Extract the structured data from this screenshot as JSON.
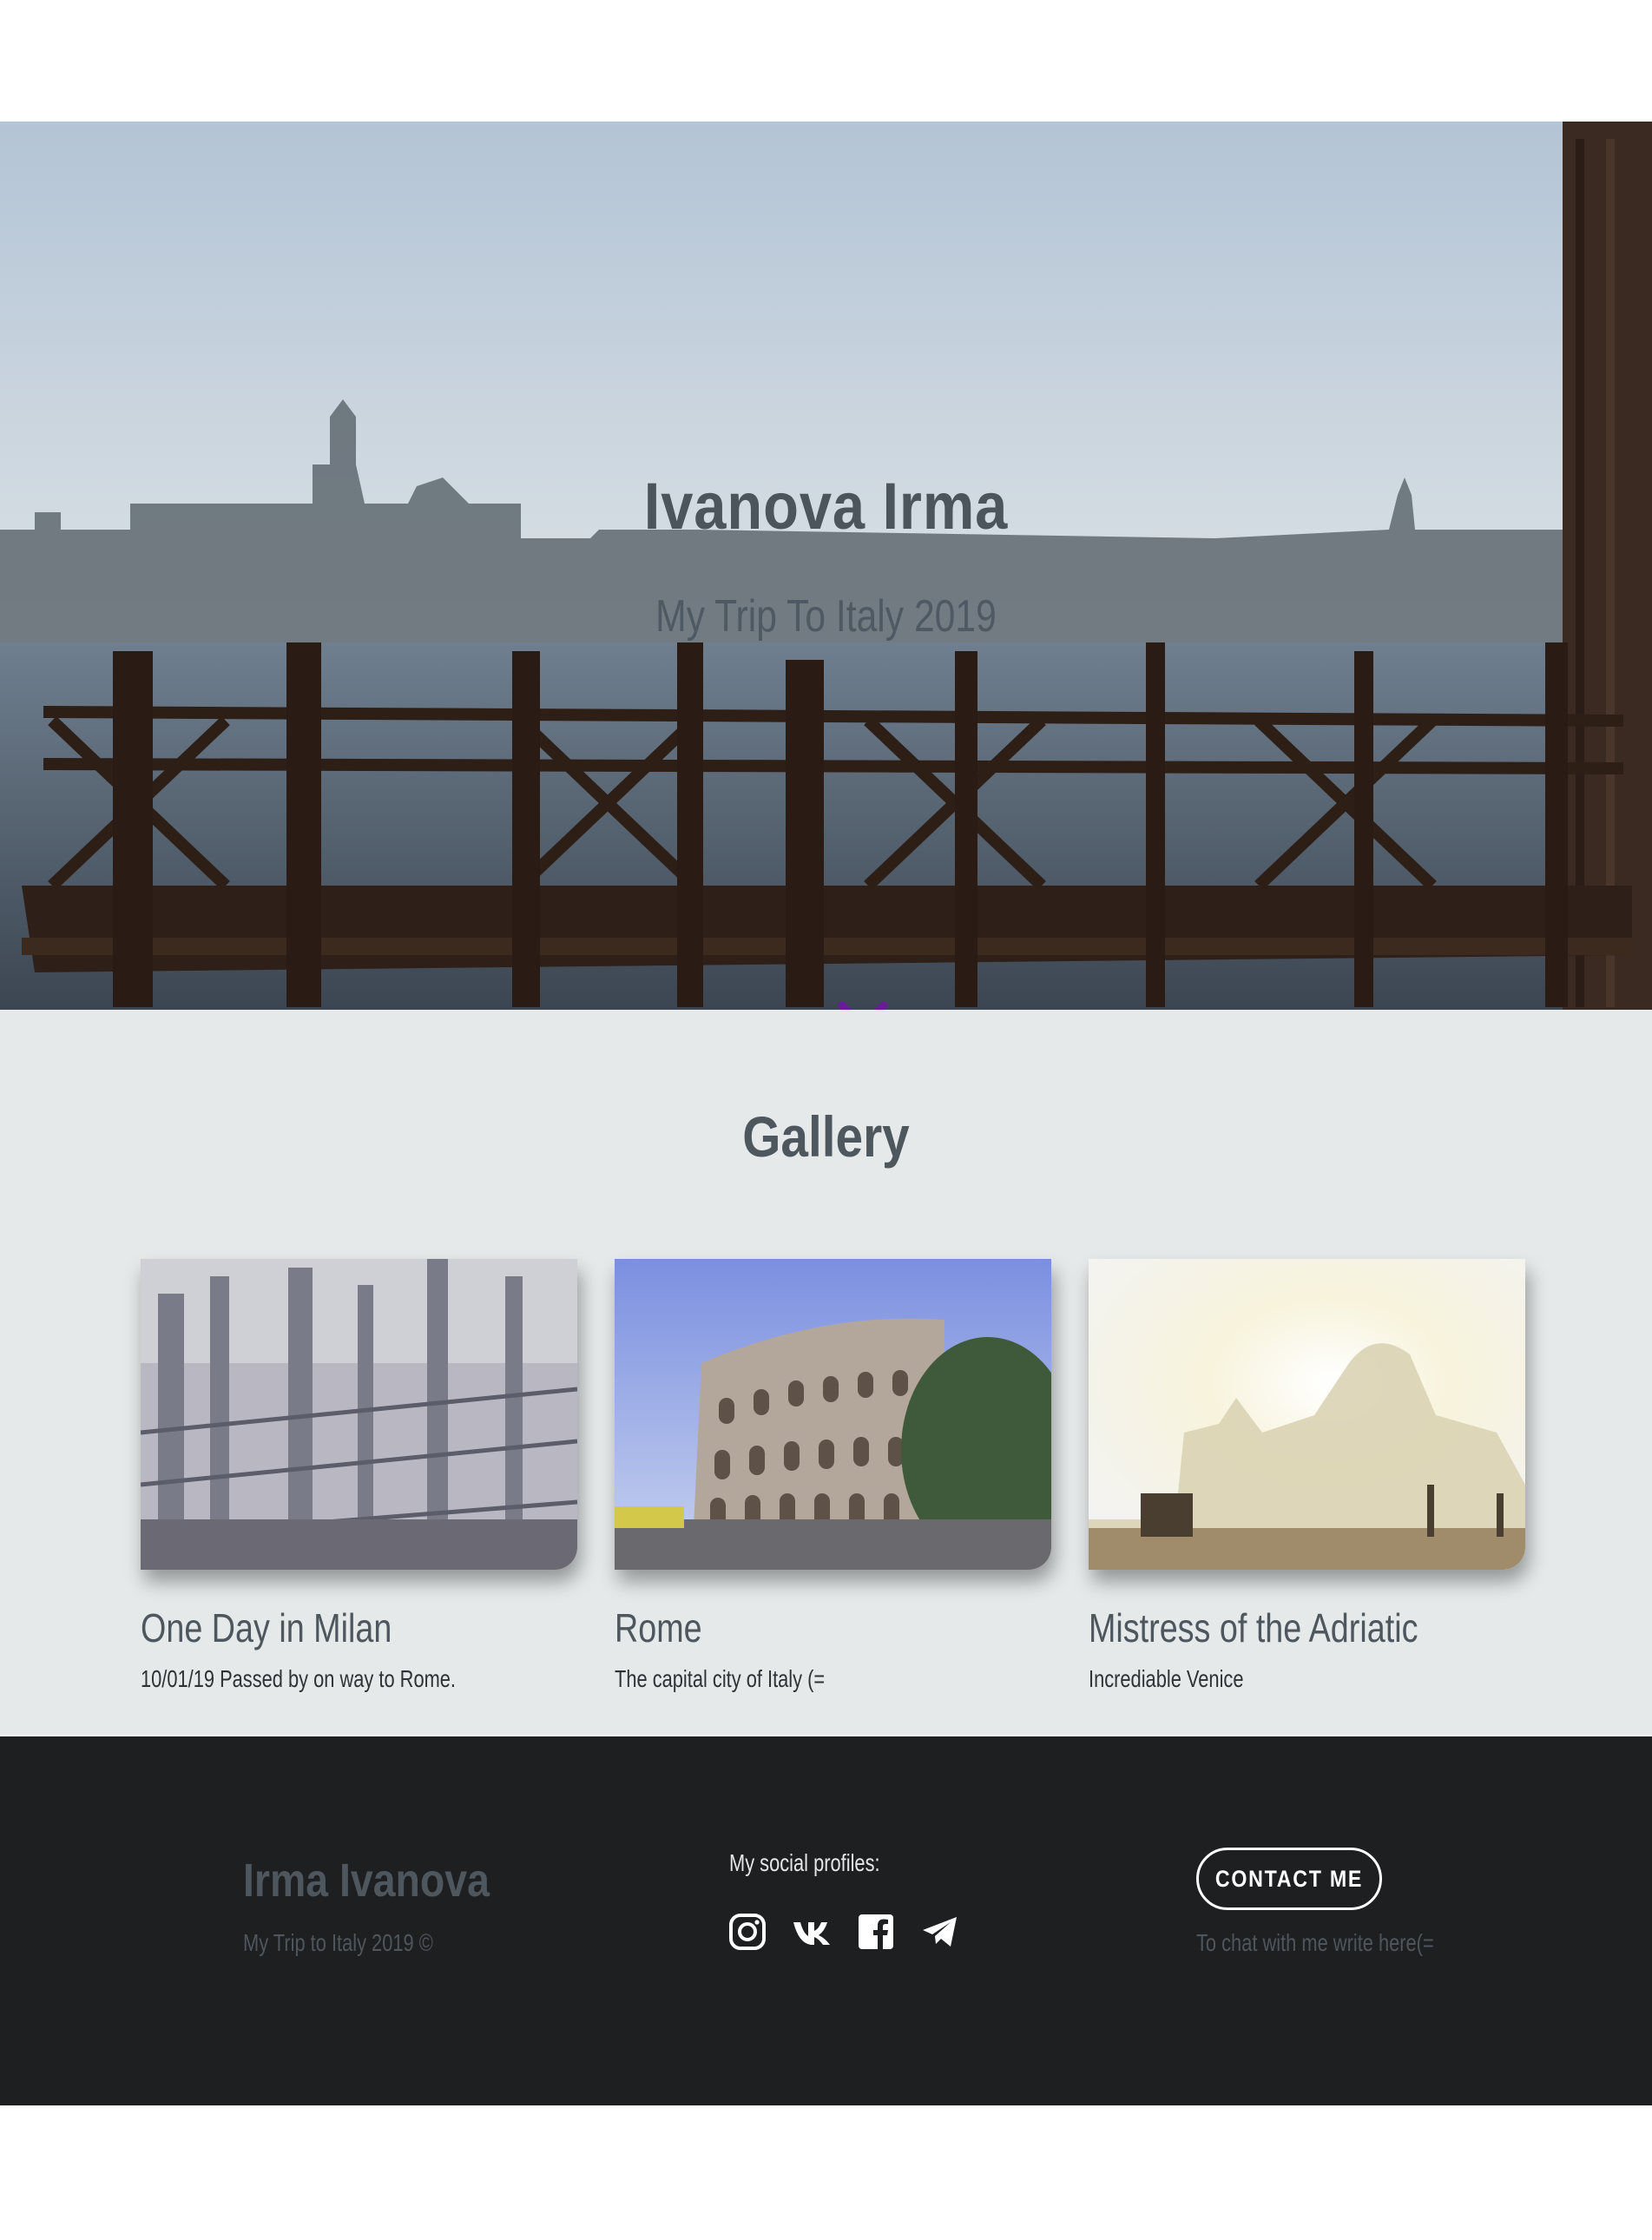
{
  "hero": {
    "title": "Ivanova Irma",
    "subtitle": "My Trip To Italy 2019",
    "scroll_icon": "chevron-down-icon",
    "accent_color": "#7b1fa2"
  },
  "gallery": {
    "title": "Gallery",
    "cards": [
      {
        "title": "One Day in Milan",
        "description": "10/01/19 Passed by on way to Rome.",
        "image": "milan-cathedral-rooftop-photo"
      },
      {
        "title": "Rome",
        "description": "The capital city of Italy (=",
        "image": "colosseum-photo"
      },
      {
        "title": "Mistress of the Adriatic",
        "description": "Incrediable Venice",
        "image": "venice-basilica-photo"
      }
    ]
  },
  "footer": {
    "name": "Irma Ivanova",
    "copyright": "My Trip to Italy 2019 ©",
    "social_label": "My social profiles:",
    "social_icons": [
      "instagram-icon",
      "vk-icon",
      "facebook-icon",
      "telegram-icon"
    ],
    "contact_button": "CONTACT ME",
    "contact_note": "To chat with me write here(="
  },
  "colors": {
    "gallery_bg": "#e5e9e9",
    "footer_bg": "#1e1f21",
    "heading": "#4e565e"
  }
}
